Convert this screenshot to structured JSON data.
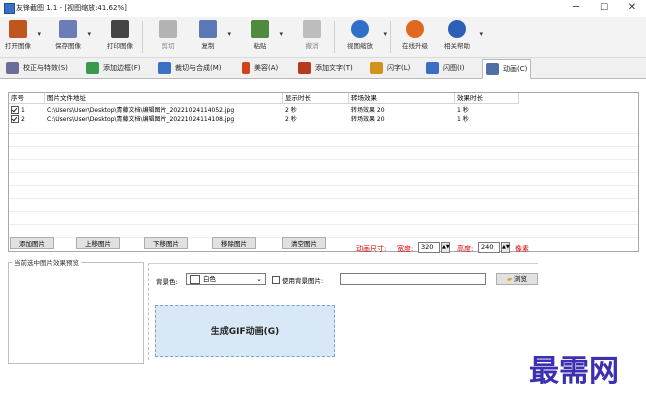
{
  "window": {
    "title": "友锋截图 1.1 - [视图缩放:41.62%]",
    "min": "─",
    "max": "☐",
    "close": "✕"
  },
  "toolbar": {
    "items": [
      {
        "label": "打开图像",
        "icon": "open-image-icon",
        "color": "#c0561d"
      },
      {
        "label": "保存图像",
        "icon": "save-image-icon",
        "color": "#6b7cb8"
      },
      {
        "label": "打印图像",
        "icon": "print-icon",
        "color": "#444444"
      },
      {
        "label": "剪切",
        "icon": "cut-icon",
        "color": "#8a8a8a"
      },
      {
        "label": "复制",
        "icon": "copy-icon",
        "color": "#5b79b9"
      },
      {
        "label": "粘贴",
        "icon": "paste-icon",
        "color": "#4f8a3e"
      },
      {
        "label": "撤消",
        "icon": "undo-icon",
        "color": "#9a9a9a"
      },
      {
        "label": "视图缩放",
        "icon": "zoom-icon",
        "color": "#2f6fc7"
      },
      {
        "label": "在线升级",
        "icon": "upgrade-icon",
        "color": "#e1681f"
      },
      {
        "label": "相关帮助",
        "icon": "help-icon",
        "color": "#2d5fb7"
      }
    ]
  },
  "tabs": [
    {
      "label": "校正与特效(S)",
      "icon": "effects-icon",
      "color": "#6c6c9a"
    },
    {
      "label": "添加边框(F)",
      "icon": "border-icon",
      "color": "#3a9a4c"
    },
    {
      "label": "裁切与合成(M)",
      "icon": "crop-icon",
      "color": "#3a6fc4"
    },
    {
      "label": "美容(A)",
      "icon": "beauty-icon",
      "color": "#d2421d"
    },
    {
      "label": "添加文字(T)",
      "icon": "text-icon",
      "color": "#b53a1e"
    },
    {
      "label": "闪字(L)",
      "icon": "flash-text-icon",
      "color": "#d2921d"
    },
    {
      "label": "闪图(I)",
      "icon": "flash-image-icon",
      "color": "#3a6fc4"
    },
    {
      "label": "动画(C)",
      "icon": "animation-icon",
      "color": "#4f6fa8"
    }
  ],
  "table": {
    "headers": [
      "序号",
      "图片文件地址",
      "显示时长",
      "转场效果",
      "效果时长"
    ],
    "rows": [
      {
        "index": "1",
        "path": "C:\\Users\\User\\Desktop\\青藤文档\\编辑图片_20221024114052.jpg",
        "duration": "2 秒",
        "effect": "转场效果 20",
        "effect_duration": "1 秒"
      },
      {
        "index": "2",
        "path": "C:\\Users\\User\\Desktop\\青藤文档\\编辑图片_20221024114108.jpg",
        "duration": "2 秒",
        "effect": "转场效果 20",
        "effect_duration": "1 秒"
      }
    ]
  },
  "buttons": {
    "add": "添加图片",
    "up": "上移图片",
    "down": "下移图片",
    "remove": "移除图片",
    "clear": "清空图片"
  },
  "size": {
    "label": "动画尺寸:",
    "width_label": "宽度:",
    "width": "320",
    "height_label": "高度:",
    "height": "240",
    "unit": "像素"
  },
  "preview": {
    "title": "当前选中图片效果预览"
  },
  "background": {
    "label": "背景色:",
    "value": "白色",
    "use_image_label": "使用背景图片:",
    "path": "",
    "browse": "浏览"
  },
  "generate": "生成GIF动画(G)",
  "watermark": "最需网"
}
